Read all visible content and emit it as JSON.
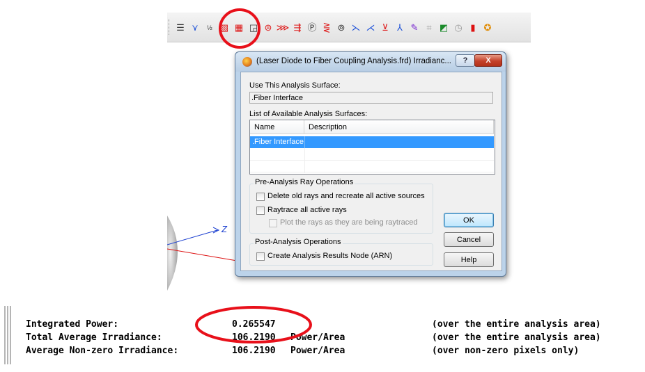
{
  "toolbar": {
    "icons": [
      "list-icon",
      "ray-icon",
      "number-icon",
      "irradiance-map-icon",
      "irradiance-plot-icon",
      "chart-icon",
      "source-icon",
      "ray-trace-icon",
      "arrow-icon",
      "parameter-icon",
      "spread-icon",
      "display-icon",
      "filter-icon",
      "filter2-icon",
      "sort-icon",
      "axes-icon",
      "leaf-icon",
      "grid-icon",
      "color-palette-icon",
      "clock-icon",
      "boxes-icon",
      "help-icon"
    ]
  },
  "view3d": {
    "axis_label": "Z"
  },
  "dialog": {
    "title": "(Laser Diode to Fiber Coupling Analysis.frd) Irradianc...",
    "help_button": "?",
    "close_button": "X",
    "use_surface_label": "Use This Analysis Surface:",
    "use_surface_value": ".Fiber Interface",
    "available_label": "List of Available Analysis Surfaces:",
    "columns": [
      "Name",
      "Description"
    ],
    "rows": [
      {
        "name": ".Fiber Interface",
        "description": ""
      }
    ],
    "pre_group": {
      "title": "Pre-Analysis Ray Operations",
      "delete_rays": "Delete old rays and recreate all active sources",
      "raytrace": "Raytrace all active rays",
      "plot_rays": "Plot the rays as they are being raytraced"
    },
    "post_group": {
      "title": "Post-Analysis Operations",
      "create_arn": "Create Analysis Results Node (ARN)"
    },
    "ok": "OK",
    "cancel": "Cancel",
    "help": "Help"
  },
  "output": {
    "lines": [
      {
        "label": "Integrated Power:",
        "value": "0.265547",
        "unit": "",
        "note": "(over the entire analysis area)"
      },
      {
        "label": "Total Average Irradiance:",
        "value": "106.2190",
        "unit": "Power/Area",
        "note": "(over the entire analysis area)"
      },
      {
        "label": "Average Non-zero Irradiance:",
        "value": "106.2190",
        "unit": "Power/Area",
        "note": "(over non-zero pixels only)"
      }
    ]
  },
  "colors": {
    "highlight_circle": "#e8101a",
    "selection": "#3399ff"
  }
}
